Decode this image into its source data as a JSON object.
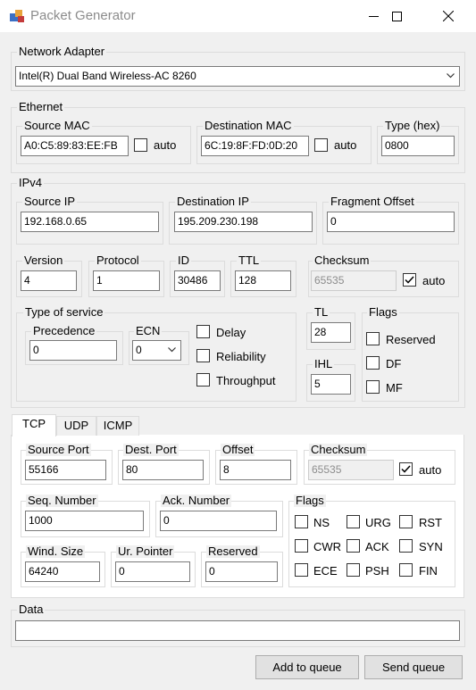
{
  "window": {
    "title": "Packet Generator"
  },
  "network_adapter": {
    "label": "Network Adapter",
    "value": "Intel(R) Dual Band Wireless-AC 8260"
  },
  "ethernet": {
    "label": "Ethernet",
    "source_mac": {
      "label": "Source MAC",
      "value": "A0:C5:89:83:EE:FB",
      "auto_label": "auto",
      "auto_checked": false
    },
    "dest_mac": {
      "label": "Destination MAC",
      "value": "6C:19:8F:FD:0D:20",
      "auto_label": "auto",
      "auto_checked": false
    },
    "type": {
      "label": "Type (hex)",
      "value": "0800"
    }
  },
  "ipv4": {
    "label": "IPv4",
    "source_ip": {
      "label": "Source IP",
      "value": "192.168.0.65"
    },
    "dest_ip": {
      "label": "Destination IP",
      "value": "195.209.230.198"
    },
    "fragment_offset": {
      "label": "Fragment Offset",
      "value": "0"
    },
    "version": {
      "label": "Version",
      "value": "4"
    },
    "protocol": {
      "label": "Protocol",
      "value": "1"
    },
    "id": {
      "label": "ID",
      "value": "30486"
    },
    "ttl": {
      "label": "TTL",
      "value": "128"
    },
    "checksum": {
      "label": "Checksum",
      "value": "65535",
      "auto_label": "auto",
      "auto_checked": true
    },
    "tos": {
      "label": "Type of service",
      "precedence": {
        "label": "Precedence",
        "value": "0"
      },
      "ecn": {
        "label": "ECN",
        "value": "0"
      },
      "delay": {
        "label": "Delay",
        "checked": false
      },
      "reliability": {
        "label": "Reliability",
        "checked": false
      },
      "throughput": {
        "label": "Throughput",
        "checked": false
      }
    },
    "tl": {
      "label": "TL",
      "value": "28"
    },
    "ihl": {
      "label": "IHL",
      "value": "5"
    },
    "flags": {
      "label": "Flags",
      "reserved": {
        "label": "Reserved",
        "checked": false
      },
      "df": {
        "label": "DF",
        "checked": false
      },
      "mf": {
        "label": "MF",
        "checked": false
      }
    }
  },
  "tabs": [
    {
      "label": "TCP",
      "active": true
    },
    {
      "label": "UDP",
      "active": false
    },
    {
      "label": "ICMP",
      "active": false
    }
  ],
  "tcp": {
    "source_port": {
      "label": "Source Port",
      "value": "55166"
    },
    "dest_port": {
      "label": "Dest. Port",
      "value": "80"
    },
    "offset": {
      "label": "Offset",
      "value": "8"
    },
    "checksum": {
      "label": "Checksum",
      "value": "65535",
      "auto_label": "auto",
      "auto_checked": true
    },
    "seq_number": {
      "label": "Seq. Number",
      "value": "1000"
    },
    "ack_number": {
      "label": "Ack. Number",
      "value": "0"
    },
    "window_size": {
      "label": "Wind. Size",
      "value": "64240"
    },
    "urgent_pointer": {
      "label": "Ur. Pointer",
      "value": "0"
    },
    "reserved": {
      "label": "Reserved",
      "value": "0"
    },
    "flags": {
      "label": "Flags",
      "items": [
        {
          "label": "NS",
          "checked": false
        },
        {
          "label": "URG",
          "checked": false
        },
        {
          "label": "RST",
          "checked": false
        },
        {
          "label": "CWR",
          "checked": false
        },
        {
          "label": "ACK",
          "checked": false
        },
        {
          "label": "SYN",
          "checked": false
        },
        {
          "label": "ECE",
          "checked": false
        },
        {
          "label": "PSH",
          "checked": false
        },
        {
          "label": "FIN",
          "checked": false
        }
      ]
    }
  },
  "data_section": {
    "label": "Data",
    "value": ""
  },
  "buttons": {
    "add_to_queue": "Add to queue",
    "send_queue": "Send queue"
  }
}
